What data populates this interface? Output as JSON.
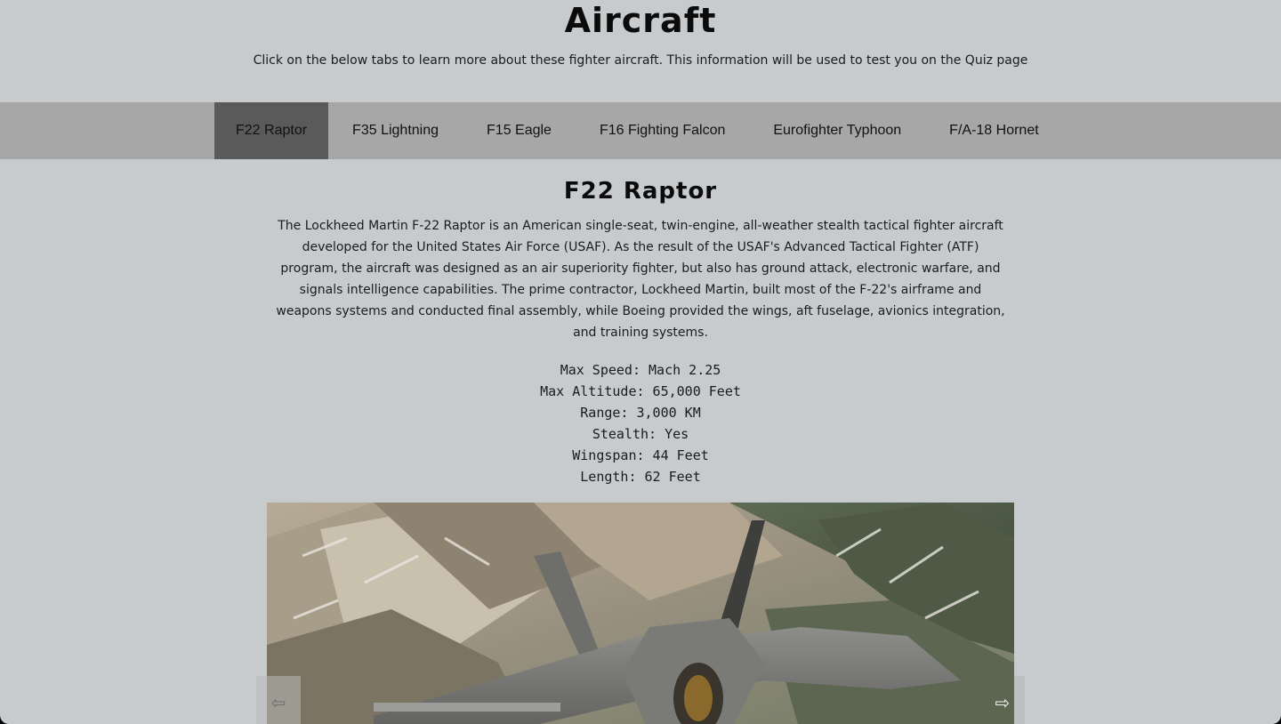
{
  "header": {
    "title": "Aircraft",
    "intro": "Click on the below tabs to learn more about these fighter aircraft. This information will be used to test you on the Quiz page"
  },
  "tabs": [
    {
      "label": "F22 Raptor",
      "active": true
    },
    {
      "label": "F35 Lightning",
      "active": false
    },
    {
      "label": "F15 Eagle",
      "active": false
    },
    {
      "label": "F16 Fighting Falcon",
      "active": false
    },
    {
      "label": "Eurofighter Typhoon",
      "active": false
    },
    {
      "label": "F/A-18 Hornet",
      "active": false
    }
  ],
  "aircraft": {
    "name": "F22 Raptor",
    "description": "The Lockheed Martin F-22 Raptor is an American single-seat, twin-engine, all-weather stealth tactical fighter aircraft developed for the United States Air Force (USAF). As the result of the USAF's Advanced Tactical Fighter (ATF) program, the aircraft was designed as an air superiority fighter, but also has ground attack, electronic warfare, and signals intelligence capabilities. The prime contractor, Lockheed Martin, built most of the F-22's airframe and weapons systems and conducted final assembly, while Boeing provided the wings, aft fuselage, avionics integration, and training systems.",
    "specs": [
      "Max Speed: Mach 2.25",
      "Max Altitude: 65,000 Feet",
      "Range: 3,000 KM",
      "Stealth: Yes",
      "Wingspan: 44 Feet",
      "Length: 62 Feet"
    ]
  },
  "carousel": {
    "prev_icon": "arrow-left-icon",
    "next_icon": "arrow-right-icon",
    "prev_glyph": "⇦",
    "next_glyph": "⇨"
  },
  "colors": {
    "background": "#c8cbce",
    "tabbar": "#a7a7a7",
    "active_tab": "#5a5a5a"
  }
}
